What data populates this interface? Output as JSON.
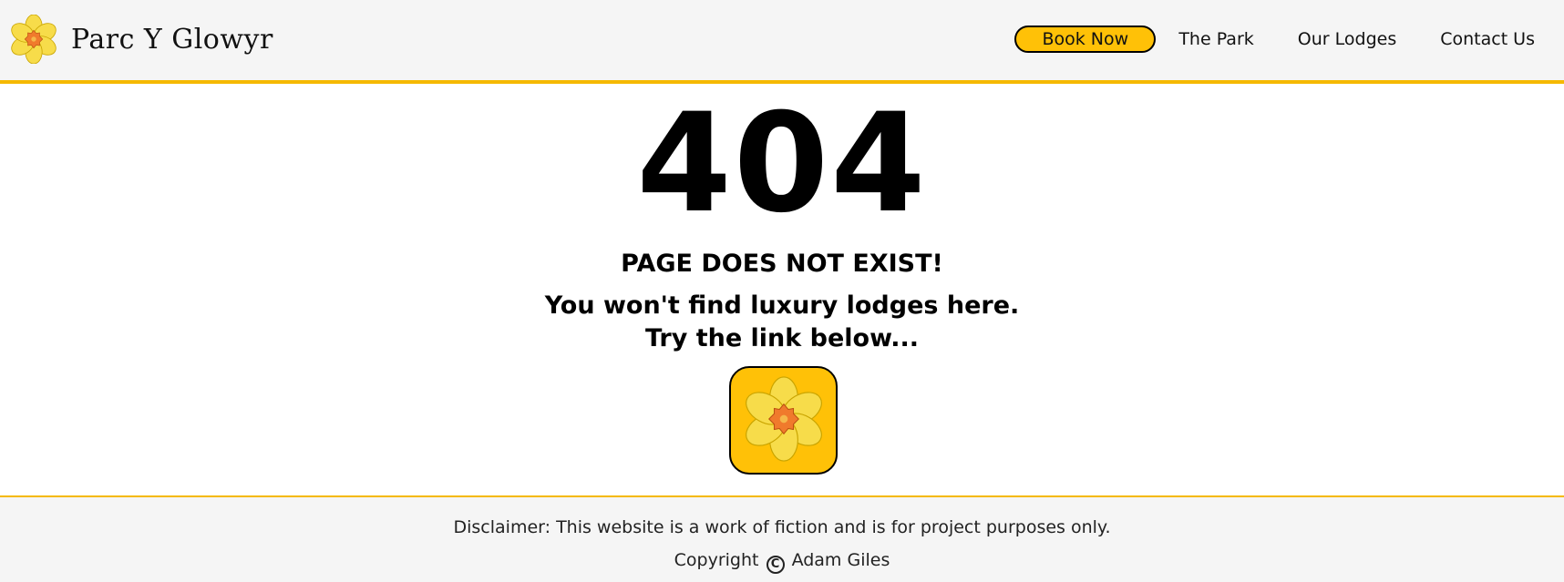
{
  "header": {
    "brand": "Parc Y Glowyr",
    "logo_icon": "daffodil-icon",
    "nav": {
      "book_now": "Book Now",
      "the_park": "The Park",
      "our_lodges": "Our Lodges",
      "contact_us": "Contact Us"
    }
  },
  "main": {
    "error_code": "404",
    "heading": "PAGE DOES NOT EXIST!",
    "message_line1": "You won't find luxury lodges here.",
    "message_line2": "Try the link below...",
    "home_button_icon": "daffodil-icon"
  },
  "footer": {
    "disclaimer": "Disclaimer: This website is a work of fiction and is for project purposes only.",
    "copyright_prefix": "Copyright",
    "copyright_symbol": "C",
    "copyright_name": "Adam Giles"
  },
  "colors": {
    "accent": "#ffc107",
    "border_accent": "#f5b900",
    "header_bg": "#f5f5f5",
    "petal": "#f7dc4a",
    "trumpet": "#f07a2c"
  }
}
